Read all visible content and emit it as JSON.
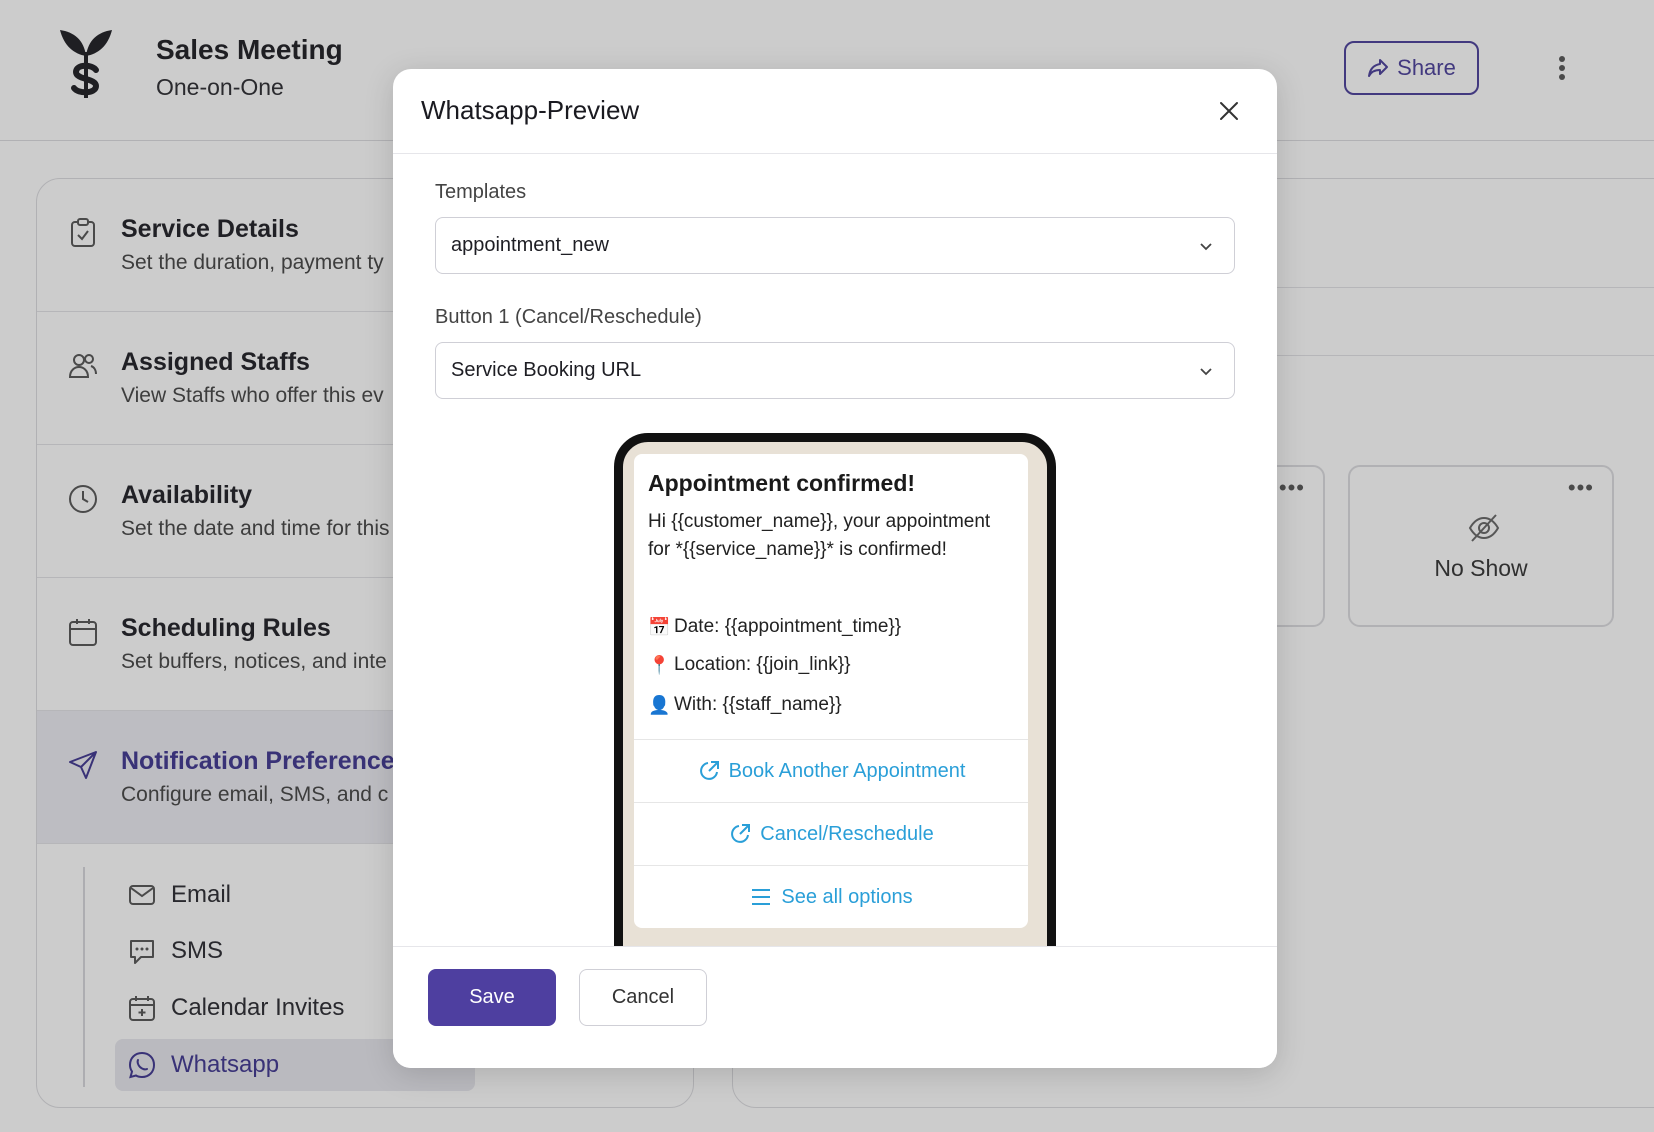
{
  "header": {
    "title": "Sales Meeting",
    "subtitle": "One-on-One",
    "share_label": "Share"
  },
  "sidebar": {
    "items": [
      {
        "title": "Service Details",
        "desc": "Set the duration, payment ty",
        "icon": "clipboard-check-icon"
      },
      {
        "title": "Assigned Staffs",
        "desc": "View Staffs who offer this ev",
        "icon": "users-icon"
      },
      {
        "title": "Availability",
        "desc": "Set the date and time for this",
        "icon": "clock-icon"
      },
      {
        "title": "Scheduling Rules",
        "desc": "Set buffers, notices, and inte",
        "icon": "calendar-icon"
      },
      {
        "title": "Notification Preferences",
        "desc": "Configure email, SMS, and c",
        "icon": "send-icon"
      }
    ],
    "sub_items": [
      "Email",
      "SMS",
      "Calendar Invites",
      "Whatsapp"
    ]
  },
  "status_cards": [
    {
      "label": "No Show",
      "icon": "eye-off-icon"
    }
  ],
  "modal": {
    "title": "Whatsapp-Preview",
    "templates_label": "Templates",
    "templates_value": "appointment_new",
    "button1_label": "Button 1 (Cancel/Reschedule)",
    "button1_value": "Service Booking URL",
    "save_label": "Save",
    "cancel_label": "Cancel"
  },
  "preview": {
    "heading": "Appointment confirmed!",
    "body": "Hi {{customer_name}}, your appointment for *{{service_name}}* is confirmed!",
    "date_emoji": "📅",
    "date_line": "Date: {{appointment_time}}",
    "location_emoji": "📍",
    "location_line": "Location: {{join_link}}",
    "staff_emoji": "👤",
    "staff_line": "With: {{staff_name}}",
    "buttons": [
      "Book Another Appointment",
      "Cancel/Reschedule",
      "See all options"
    ]
  },
  "colors": {
    "primary": "#4e3fa0",
    "link": "#2a9fd8",
    "overlay": "rgba(40,40,40,0.24)"
  }
}
